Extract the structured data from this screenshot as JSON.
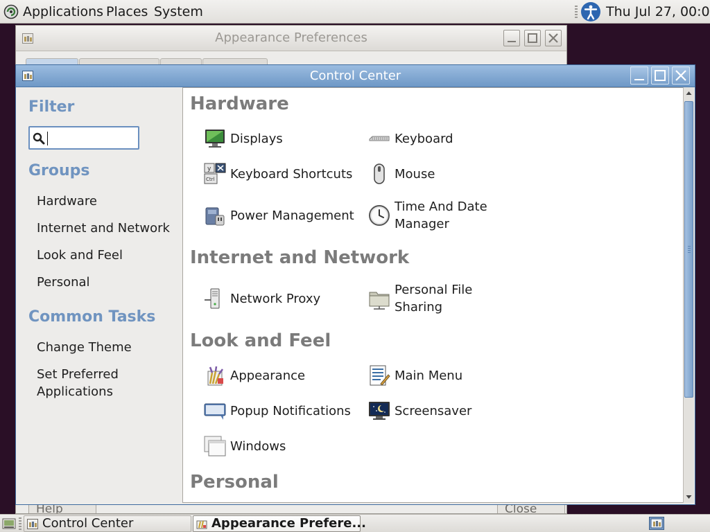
{
  "top_panel": {
    "menus": [
      "Applications",
      "Places",
      "System"
    ],
    "clock": "Thu Jul 27, 00:01"
  },
  "background_window": {
    "title": "Appearance Preferences",
    "help_label": "Help",
    "close_label": "Close"
  },
  "control_center": {
    "title": "Control Center",
    "sidebar": {
      "filter_heading": "Filter",
      "filter_value": "",
      "groups_heading": "Groups",
      "groups": [
        "Hardware",
        "Internet and Network",
        "Look and Feel",
        "Personal"
      ],
      "tasks_heading": "Common Tasks",
      "tasks": [
        "Change Theme",
        "Set Preferred Applications"
      ]
    },
    "sections": [
      {
        "heading": "Hardware",
        "items": [
          {
            "label": "Displays",
            "icon": "display-icon"
          },
          {
            "label": "Keyboard",
            "icon": "keyboard-icon"
          },
          {
            "label": "Keyboard Shortcuts",
            "icon": "keyboard-shortcuts-icon"
          },
          {
            "label": "Mouse",
            "icon": "mouse-icon"
          },
          {
            "label": "Power Management",
            "icon": "power-management-icon"
          },
          {
            "label": "Time And Date Manager",
            "icon": "clock-icon"
          }
        ]
      },
      {
        "heading": "Internet and Network",
        "items": [
          {
            "label": "Network Proxy",
            "icon": "network-proxy-icon"
          },
          {
            "label": "Personal File Sharing",
            "icon": "file-sharing-icon"
          }
        ]
      },
      {
        "heading": "Look and Feel",
        "items": [
          {
            "label": "Appearance",
            "icon": "appearance-icon"
          },
          {
            "label": "Main Menu",
            "icon": "main-menu-icon"
          },
          {
            "label": "Popup Notifications",
            "icon": "notification-icon"
          },
          {
            "label": "Screensaver",
            "icon": "screensaver-icon"
          },
          {
            "label": "Windows",
            "icon": "windows-icon"
          }
        ]
      },
      {
        "heading": "Personal",
        "items": []
      }
    ]
  },
  "bottom_panel": {
    "tasks": [
      "Control Center",
      "Appearance Prefere..."
    ]
  },
  "colors": {
    "accent": "#7094c0",
    "titlebar_active": "#7aa1cc",
    "section_heading": "#7b7b7b"
  }
}
